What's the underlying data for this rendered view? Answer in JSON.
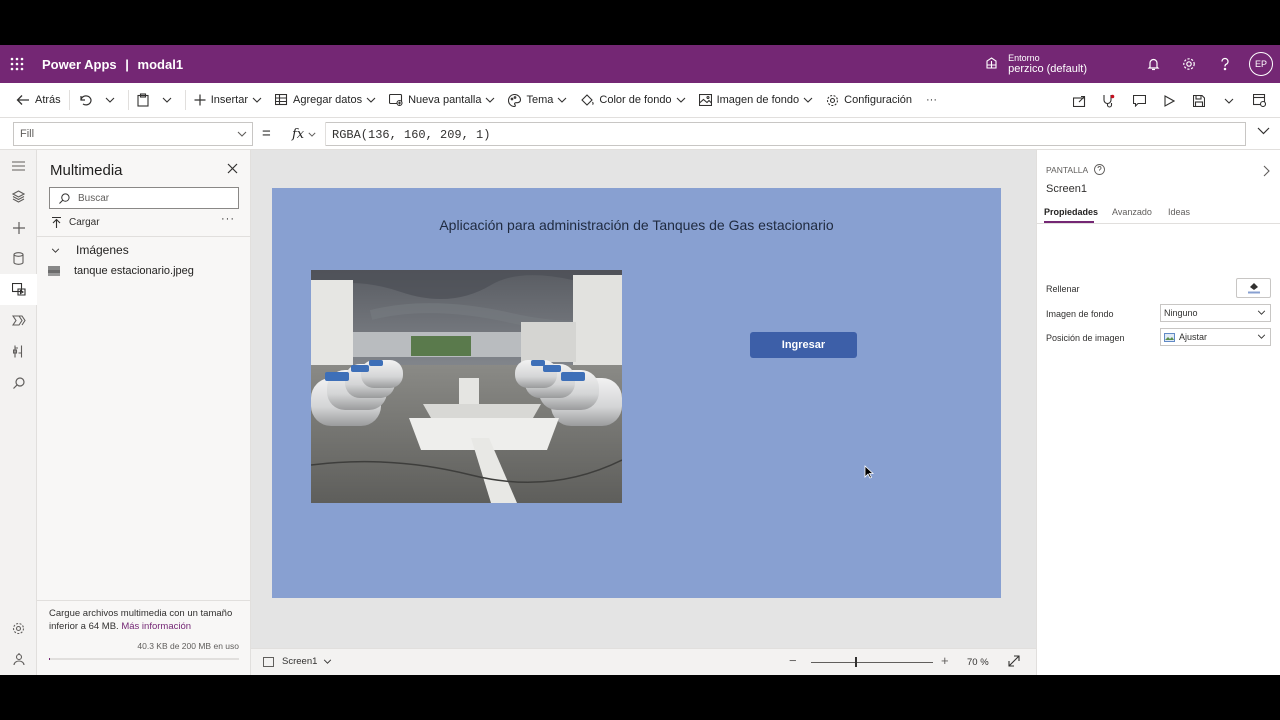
{
  "header": {
    "app_name": "Power Apps",
    "separator": "|",
    "document_name": "modal1",
    "environment_label": "Entorno",
    "environment_name": "perzico (default)",
    "avatar_initials": "EP"
  },
  "toolbar": {
    "back": "Atrás",
    "insert": "Insertar",
    "add_data": "Agregar datos",
    "new_screen": "Nueva pantalla",
    "theme": "Tema",
    "background_color": "Color de fondo",
    "background_image": "Imagen de fondo",
    "settings": "Configuración",
    "more": "···"
  },
  "formula_bar": {
    "property": "Fill",
    "equals": "=",
    "fx": "fx",
    "formula": "RGBA(136, 160, 209, 1)"
  },
  "media_panel": {
    "title": "Multimedia",
    "search_placeholder": "Buscar",
    "upload": "Cargar",
    "more": "···",
    "images_header": "Imágenes",
    "files": [
      "tanque estacionario.jpeg"
    ],
    "upload_info": "Cargue archivos multimedia con un tamaño inferior a 64 MB.",
    "more_info_link": "Más información",
    "storage_used": "40.3 KB de 200 MB en uso",
    "storage_fraction": 0.0002
  },
  "screen": {
    "background_color": "#88a0d1",
    "title": "Aplicación para administración de Tanques de Gas estacionario",
    "button_label": "Ingresar"
  },
  "status_bar": {
    "screen_name": "Screen1",
    "zoom_minus": "−",
    "zoom_plus": "+",
    "zoom_value": "70 %",
    "zoom_percent": 70
  },
  "properties_panel": {
    "kind": "PANTALLA",
    "name": "Screen1",
    "tabs": [
      "Propiedades",
      "Avanzado",
      "Ideas"
    ],
    "fill_label": "Rellenar",
    "background_image_label": "Imagen de fondo",
    "background_image_value": "Ninguno",
    "image_position_label": "Posición de imagen",
    "image_position_value": "Ajustar"
  },
  "colors": {
    "brand": "#742774",
    "button": "#3d5fa8"
  }
}
